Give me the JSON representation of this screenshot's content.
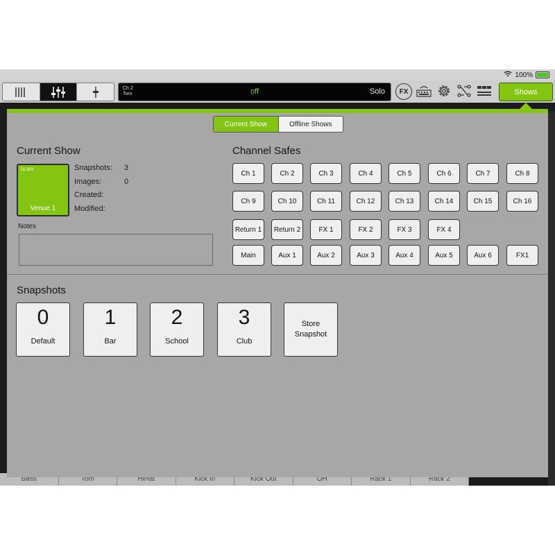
{
  "status": {
    "battery": "100%"
  },
  "toolbar": {
    "channel_display": {
      "line1": "Ch 2",
      "line2": "Tom",
      "state": "off",
      "solo": "Solo"
    },
    "fx_label": "FX",
    "shows_label": "Shows",
    "icons": [
      "mixer-view-icon",
      "channel-view-icon",
      "fader-view-icon",
      "fx-icon",
      "keyboard-icon",
      "gear-icon",
      "routing-icon",
      "mute-groups-icon"
    ]
  },
  "tabs": [
    "Current Show",
    "Offline Shows"
  ],
  "current_show": {
    "heading": "Current Show",
    "tile_model": "DL16S",
    "tile_name": "Venue 1",
    "fields": [
      {
        "label": "Snapshots:",
        "value": "3"
      },
      {
        "label": "Images:",
        "value": "0"
      },
      {
        "label": "Created:",
        "value": ""
      },
      {
        "label": "Modified:",
        "value": ""
      }
    ],
    "notes_label": "Notes"
  },
  "channel_safes": {
    "heading": "Channel Safes",
    "rows": [
      [
        "Ch 1",
        "Ch 2",
        "Ch 3",
        "Ch 4",
        "Ch 5",
        "Ch 6",
        "Ch 7",
        "Ch 8"
      ],
      [
        "Ch 9",
        "Ch 10",
        "Ch 11",
        "Ch 12",
        "Ch 13",
        "Ch 14",
        "Ch 15",
        "Ch 16"
      ],
      [
        "Return 1",
        "Return 2",
        "FX 1",
        "FX 2",
        "FX 3",
        "FX 4"
      ],
      [
        "Main",
        "Aux 1",
        "Aux 2",
        "Aux 3",
        "Aux 4",
        "Aux 5",
        "Aux 6",
        "FX1"
      ]
    ]
  },
  "snapshots": {
    "heading": "Snapshots",
    "items": [
      {
        "num": "0",
        "name": "Default"
      },
      {
        "num": "1",
        "name": "Bar"
      },
      {
        "num": "2",
        "name": "School"
      },
      {
        "num": "3",
        "name": "Club"
      }
    ],
    "store_label_1": "Store",
    "store_label_2": "Snapshot"
  },
  "strip_names": [
    "Bass",
    "Tom",
    "HiHat",
    "Kick In",
    "Kick Out",
    "OH",
    "Rack 1",
    "Rack 2"
  ],
  "colors": {
    "accent": "#84c514",
    "panel": "#a7a7a7",
    "button": "#efefef"
  }
}
